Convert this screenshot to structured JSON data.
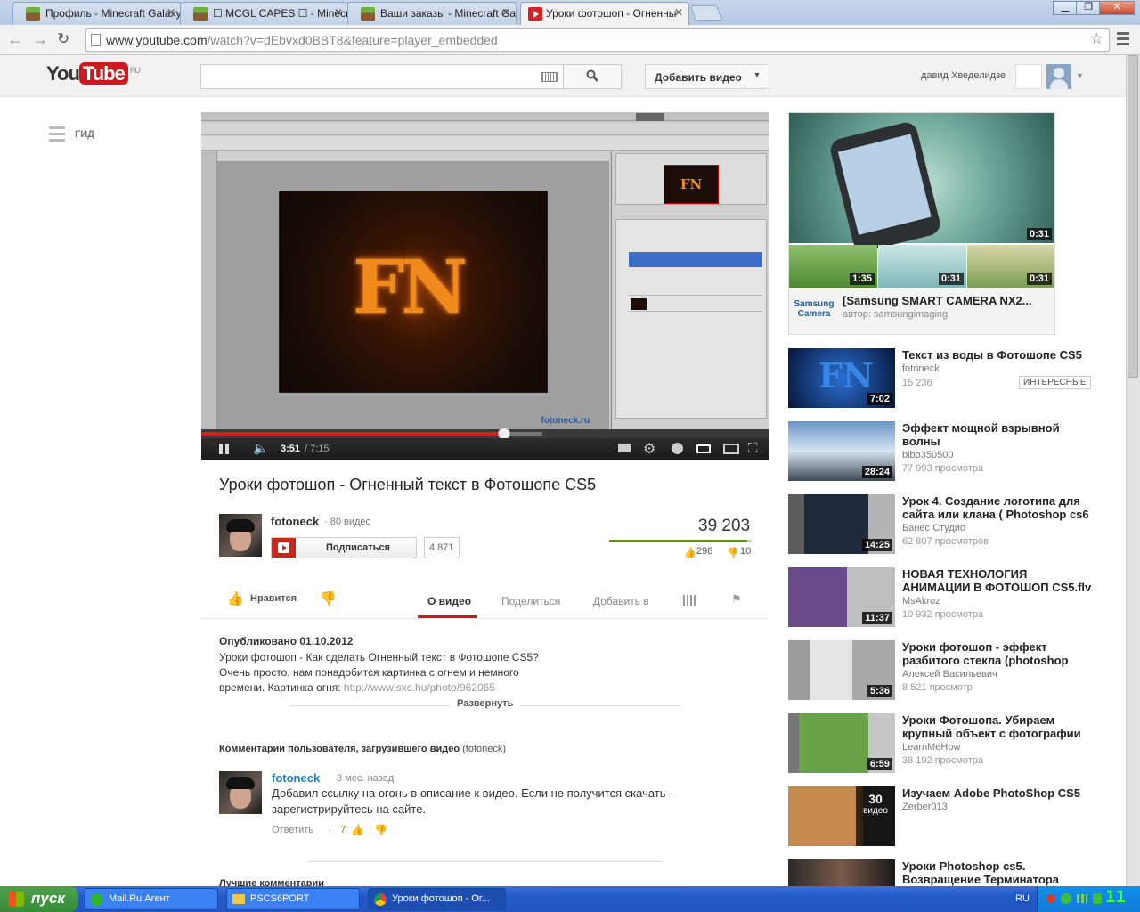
{
  "browser": {
    "tabs": [
      {
        "label": "Профиль - Minecraft Galaxy",
        "icon": "minecraft-icon"
      },
      {
        "label": "☐ MCGL CAPES ☐ - Minecra",
        "icon": "minecraft-icon"
      },
      {
        "label": "Ваши заказы - Minecraft Gal",
        "icon": "minecraft-icon"
      },
      {
        "label": "Уроки фотошоп - Огненны",
        "icon": "youtube-icon"
      }
    ],
    "url_host": "www.youtube.com",
    "url_rest": "/watch?v=dEbvxd0BBT8&feature=player_embedded"
  },
  "youtube": {
    "logo_you": "You",
    "logo_tube": "Tube",
    "logo_region": "RU",
    "upload_label": "Добавить видео",
    "username": "давид Хведелидзе",
    "guide_label": "ГИД"
  },
  "player": {
    "app_name": "Adobe Photoshop CS5",
    "artwork_text": "FN",
    "watermark": "fotoneck.ru",
    "current_time": "3:51",
    "duration": "/ 7:15",
    "progress_played": 0.533,
    "progress_loaded": 0.6
  },
  "video": {
    "title": "Уроки фотошоп - Огненный текст в Фотошопе CS5",
    "channel": "fotoneck",
    "video_count": "· 80 видео",
    "subscribe_label": "Подписаться",
    "subscriber_count": "4 871",
    "views": "39 203",
    "likes": "298",
    "dislikes": "10",
    "like_label": "Нравится",
    "tabs": [
      "О видео",
      "Поделиться",
      "Добавить в"
    ],
    "published": "Опубликовано 01.10.2012",
    "description_lines": [
      "Уроки фотошоп - Как сделать Огненный текст в Фотошопе CS5?",
      "Очень просто, нам понадобится картинка с огнем и немного",
      "времени. Картинка огня: "
    ],
    "description_link": "http://www.sxc.hu/photo/962065",
    "expand_label": "Развернуть"
  },
  "comments": {
    "header": "Комментарии пользователя, загрузившего видео",
    "header_user": "(fotoneck)",
    "items": [
      {
        "author": "fotoneck",
        "time": "3 мес. назад",
        "text_line1": "Добавил ссылку на огонь в описание к видео. Если не получится скачать -",
        "text_line2": "зарегистрируйтесь на сайте.",
        "reply_label": "Ответить",
        "likes": "7"
      }
    ],
    "best_header": "Лучшие комментарии"
  },
  "ad": {
    "title": "[Samsung SMART CAMERA NX2...",
    "author": "автор: samsungimaging",
    "brand_line1": "Samsung",
    "brand_line2": "Camera",
    "main_duration": "0:31",
    "thumb_durations": [
      "1:35",
      "0:31",
      "0:31"
    ]
  },
  "recommendations": [
    {
      "title": "Текст из воды в Фотошопе CS5",
      "author": "fotoneck",
      "views": "15 236",
      "duration": "7:02",
      "badge": "ИНТЕРЕСНЫЕ"
    },
    {
      "title": "Эффект мощной взрывной волны",
      "author": "bibo350500",
      "views": "77 993 просмотра",
      "duration": "28:24"
    },
    {
      "title": "Урок 4. Создание логотипа для сайта или клана ( Photoshop cs6",
      "author": "Банес Студио",
      "views": "62 807 просмотров",
      "duration": "14:25"
    },
    {
      "title": "НОВАЯ ТЕХНОЛОГИЯ АНИМАЦИИ В ФОТОШОП CS5.flv",
      "author": "MsAkroz",
      "views": "10 932 просмотра",
      "duration": "11:37"
    },
    {
      "title": "Уроки фотошоп - эффект разбитого стекла (photoshop",
      "author": "Алексей Васильевич",
      "views": "8 521 просмотр",
      "duration": "5:36"
    },
    {
      "title": "Уроки Фотошопа. Убираем крупный объект с фотографии",
      "author": "LearnMeHow",
      "views": "38 192 просмотра",
      "duration": "6:59"
    },
    {
      "title": "Изучаем Adobe PhotoShop CS5",
      "author": "Zerber013",
      "views": "",
      "duration": "",
      "playlist_count": "30",
      "playlist_label": "видео"
    },
    {
      "title": "Уроки Photoshop cs5. Возвращение Терминатора",
      "author": "",
      "views": "",
      "duration": ""
    }
  ],
  "taskbar": {
    "start_label": "пуск",
    "items": [
      "Mail.Ru Агент",
      "PSCS6PORT",
      "Уроки фотошоп - Ог..."
    ],
    "lang": "RU",
    "clock": "11"
  },
  "colors": {
    "youtube_red": "#cc181e",
    "link_blue": "#1b7fcc",
    "progress_red": "#d21f1f"
  }
}
